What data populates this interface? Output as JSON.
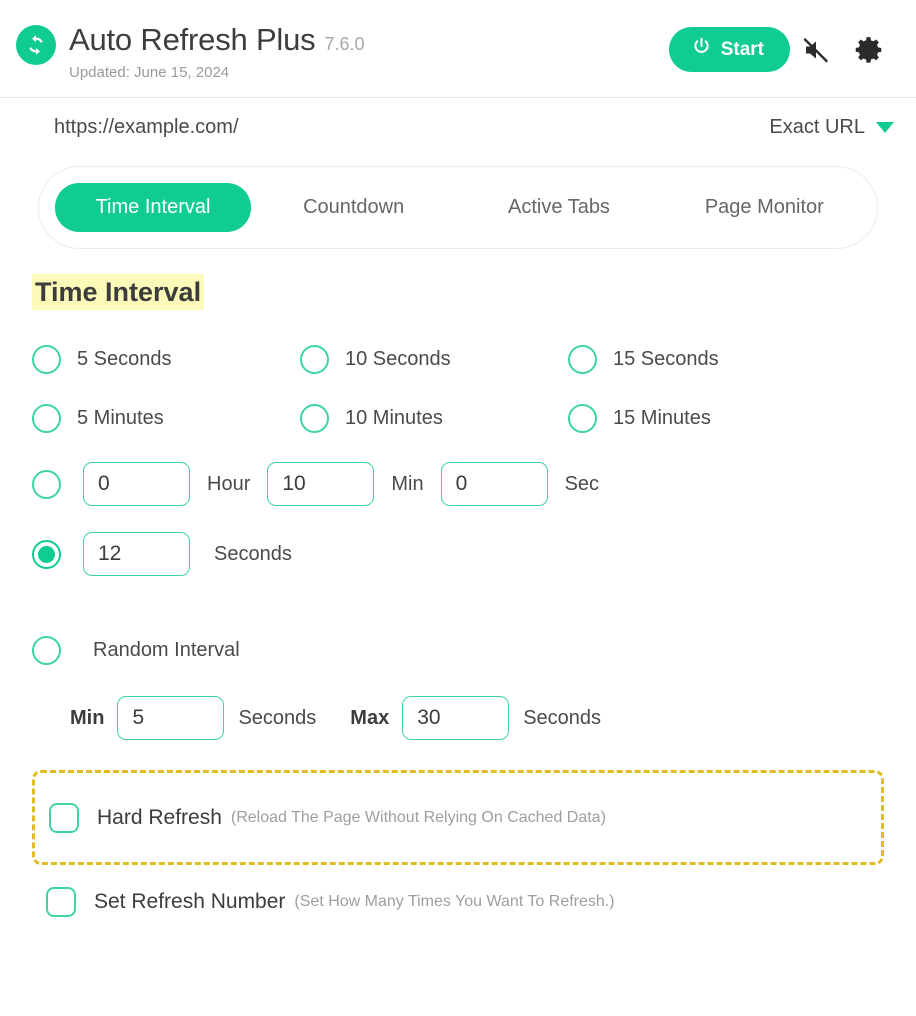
{
  "header": {
    "logo_icon": "refresh-circle-icon",
    "app_title": "Auto Refresh Plus",
    "version": "7.6.0",
    "updated": "Updated: June 15, 2024",
    "start_label": "Start",
    "power_icon": "power-icon",
    "mute_icon": "speaker-muted-icon",
    "settings_icon": "gear-icon"
  },
  "url_bar": {
    "url": "https://example.com/",
    "match_mode": "Exact URL",
    "caret_icon": "chevron-down-icon"
  },
  "tabs": [
    {
      "label": "Time Interval",
      "active": true
    },
    {
      "label": "Countdown",
      "active": false
    },
    {
      "label": "Active Tabs",
      "active": false
    },
    {
      "label": "Page Monitor",
      "active": false
    }
  ],
  "section": {
    "heading": "Time Interval"
  },
  "presets": [
    "5 Seconds",
    "10 Seconds",
    "15 Seconds",
    "5 Minutes",
    "10 Minutes",
    "15 Minutes"
  ],
  "custom_time": {
    "hour_value": "0",
    "hour_label": "Hour",
    "min_value": "10",
    "min_label": "Min",
    "sec_value": "0",
    "sec_label": "Sec"
  },
  "seconds_option": {
    "value": "12",
    "label": "Seconds",
    "selected": true
  },
  "random_interval": {
    "label": "Random Interval",
    "min_label": "Min",
    "min_value": "5",
    "min_unit": "Seconds",
    "max_label": "Max",
    "max_value": "30",
    "max_unit": "Seconds"
  },
  "hard_refresh": {
    "label": "Hard Refresh",
    "hint": "(Reload The Page Without Relying On Cached Data)",
    "checked": false
  },
  "refresh_number": {
    "label": "Set Refresh Number",
    "hint": "(Set How Many Times You Want To Refresh.)",
    "checked": false
  },
  "colors": {
    "brand_green": "#10cc93",
    "radio_green": "#3fd4a5",
    "highlight_yellow": "#fcfab8",
    "dashed_gold": "#e0bd22",
    "text_dark": "#3c3c3c",
    "text_muted": "#9e9e9e"
  }
}
